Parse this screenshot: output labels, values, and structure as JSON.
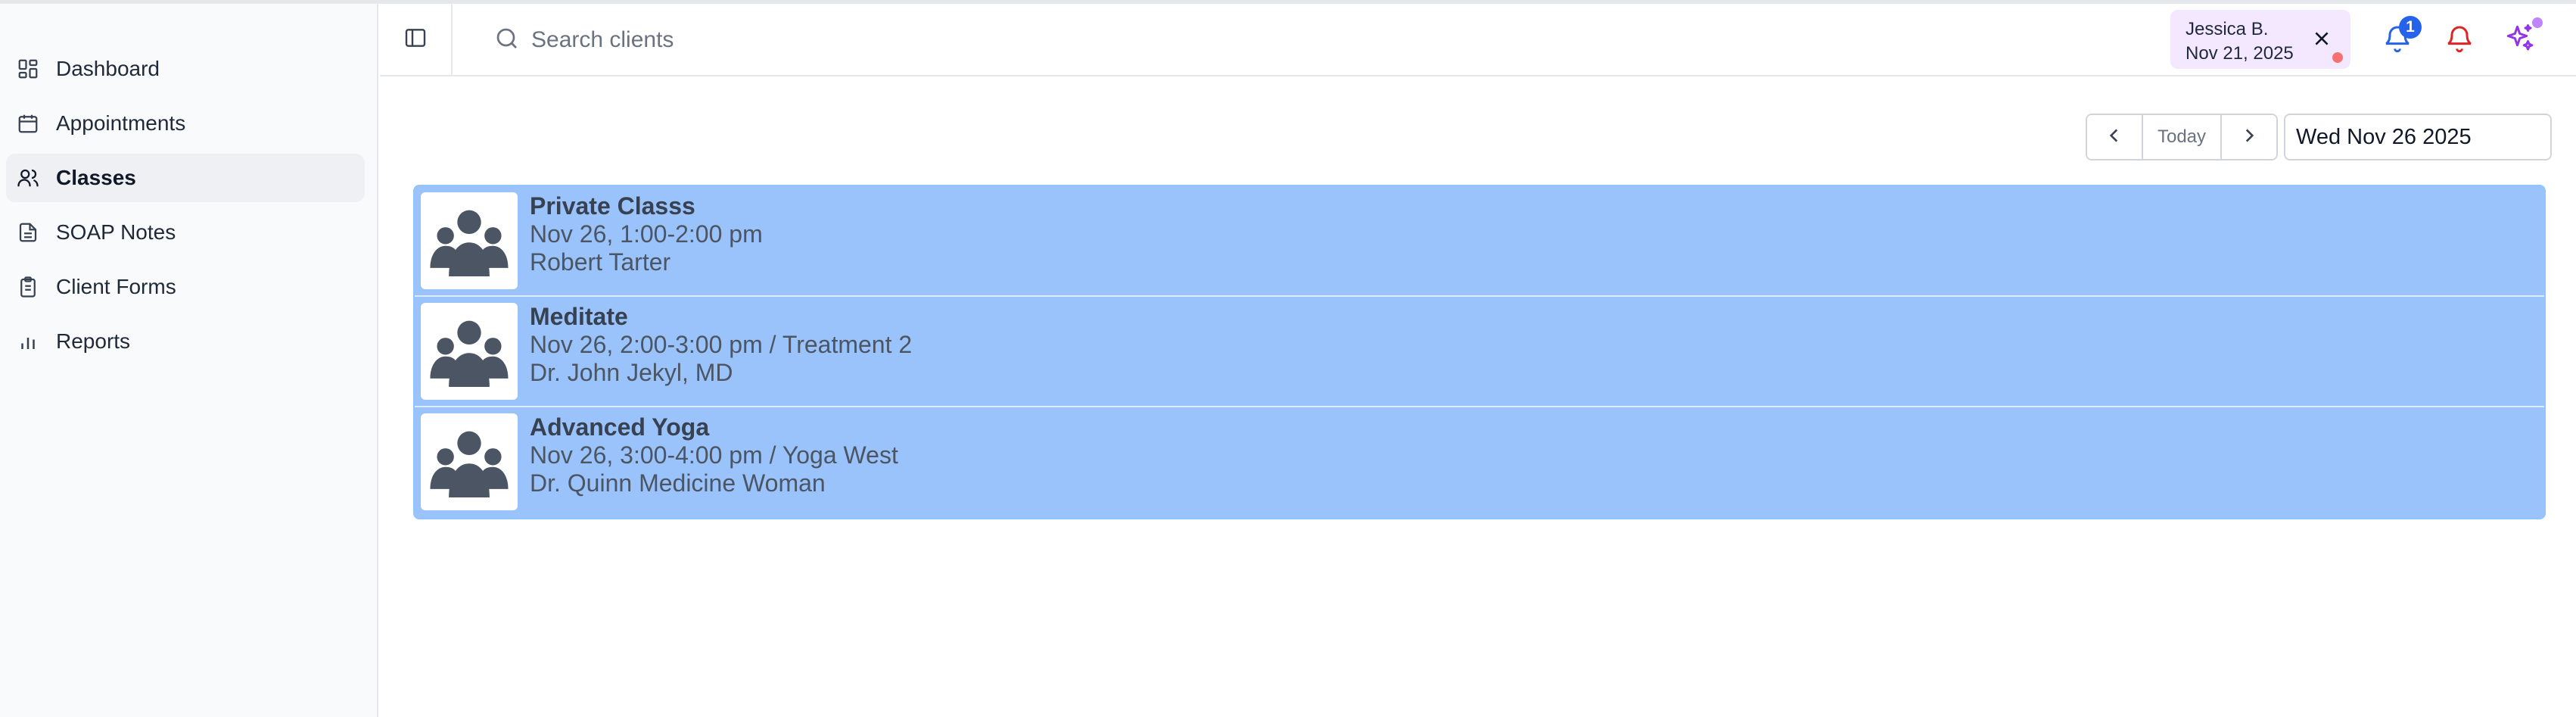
{
  "sidebar": {
    "items": [
      {
        "label": "Dashboard",
        "icon": "dashboard-icon"
      },
      {
        "label": "Appointments",
        "icon": "calendar-icon"
      },
      {
        "label": "Classes",
        "icon": "users-icon",
        "active": true
      },
      {
        "label": "SOAP Notes",
        "icon": "document-icon"
      },
      {
        "label": "Client Forms",
        "icon": "clipboard-icon"
      },
      {
        "label": "Reports",
        "icon": "bar-chart-icon"
      }
    ]
  },
  "header": {
    "search": {
      "placeholder": "Search clients"
    },
    "client_chip": {
      "name": "Jessica B.",
      "date": "Nov 21, 2025"
    },
    "notifications": {
      "count": "1"
    }
  },
  "date_nav": {
    "today_label": "Today",
    "date_value": "Wed Nov 26 2025"
  },
  "classes": [
    {
      "title": "Private Classs",
      "time": "Nov 26, 1:00-2:00 pm",
      "instructor": "Robert Tarter"
    },
    {
      "title": "Meditate",
      "time": "Nov 26, 2:00-3:00 pm / Treatment 2",
      "instructor": "Dr. John Jekyl, MD"
    },
    {
      "title": "Advanced Yoga",
      "time": "Nov 26, 3:00-4:00 pm / Yoga West",
      "instructor": "Dr. Quinn Medicine Woman"
    }
  ],
  "colors": {
    "row_bg": "#9ac3fb",
    "badge": "#2563eb",
    "bell_alert": "#dc2626",
    "sparkle": "#9333ea",
    "chip_bg": "#f3e8ff"
  }
}
